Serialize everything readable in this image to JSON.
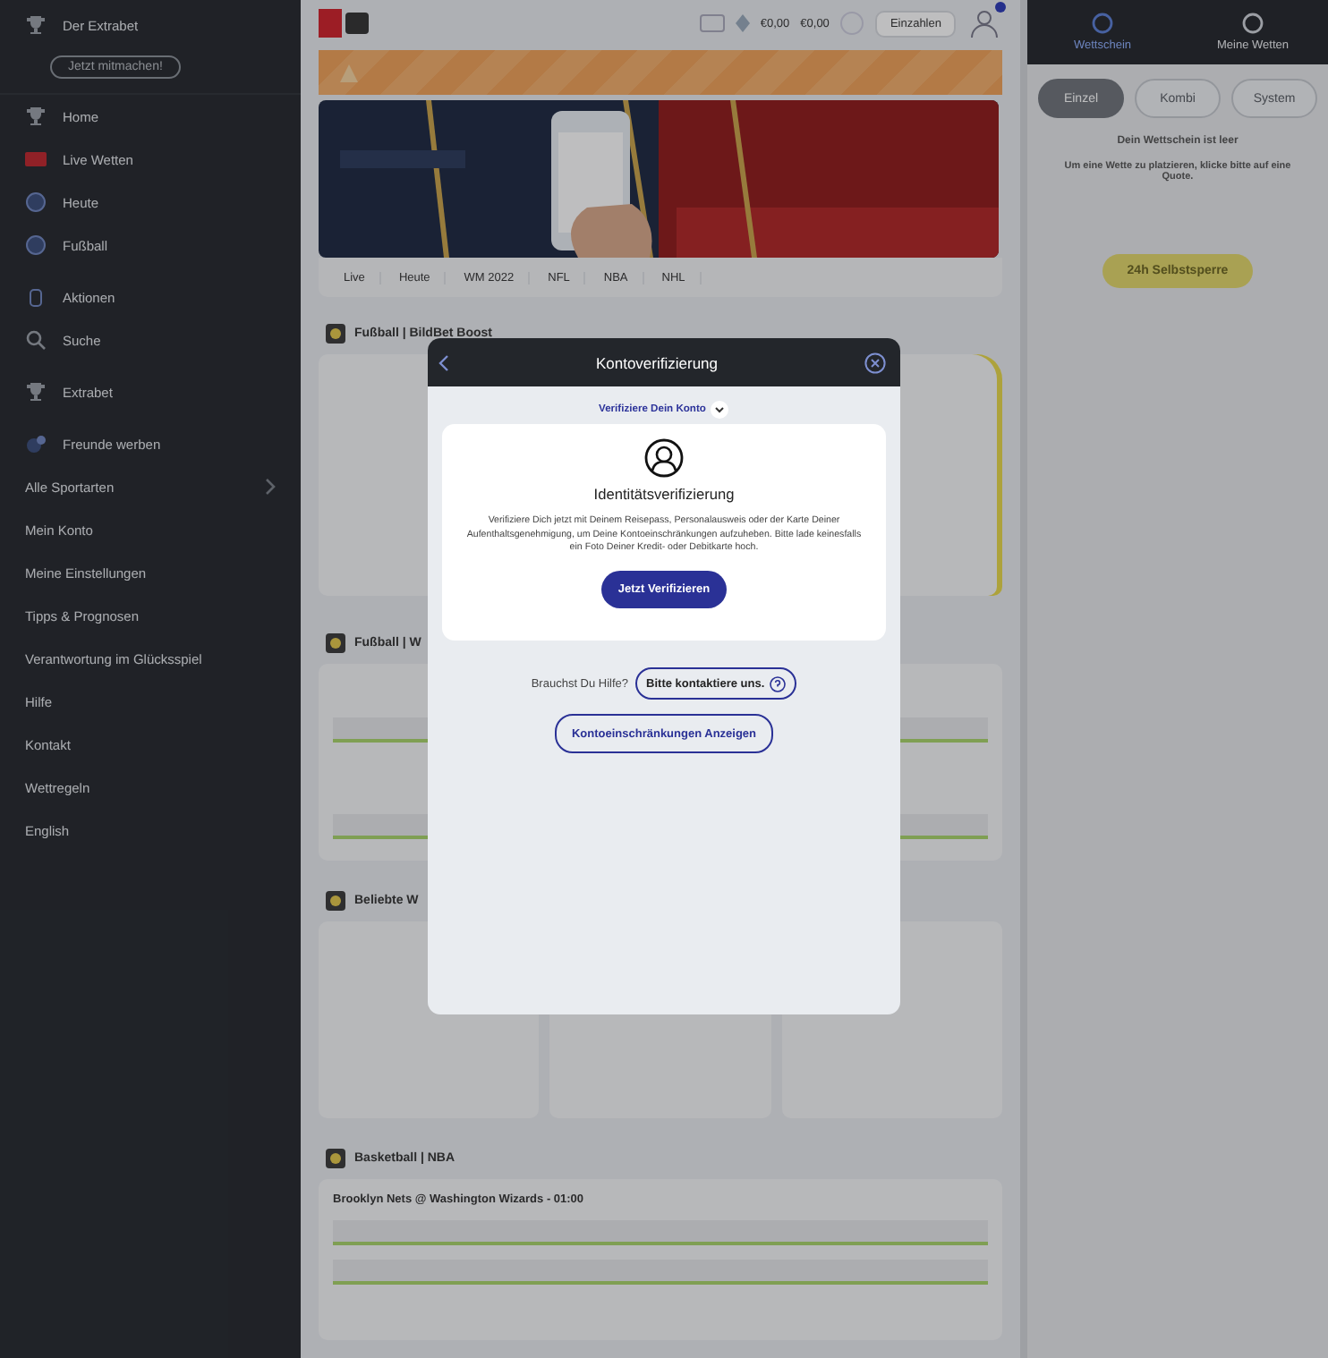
{
  "sidebar": {
    "promo": {
      "title": "Der Extrabet",
      "button": "Jetzt mitmachen!"
    },
    "nav": [
      {
        "label": "Home"
      },
      {
        "label": "Live Wetten"
      },
      {
        "label": "Heute"
      },
      {
        "label": "Fußball"
      },
      {
        "label": "Aktionen"
      },
      {
        "label": "Suche"
      },
      {
        "label": "Extrabet"
      },
      {
        "label": "Freunde werben"
      }
    ],
    "links": [
      {
        "label": "Alle Sportarten",
        "expandable": true
      },
      {
        "label": "Mein Konto",
        "expandable": false
      },
      {
        "label": "Meine Einstellungen",
        "expandable": false
      },
      {
        "label": "Tipps & Prognosen",
        "expandable": false
      },
      {
        "label": "Verantwortung im Glücksspiel",
        "expandable": false
      },
      {
        "label": "Hilfe",
        "expandable": false
      },
      {
        "label": "Kontakt",
        "expandable": false
      },
      {
        "label": "Wettregeln",
        "expandable": false
      },
      {
        "label": "English",
        "expandable": false
      }
    ]
  },
  "header": {
    "balance": "€0,00",
    "bonus": "€0,00",
    "deposit_button": "Einzahlen"
  },
  "tabs": [
    {
      "label": "Live"
    },
    {
      "label": "Heute"
    },
    {
      "label": "WM 2022"
    },
    {
      "label": "NFL"
    },
    {
      "label": "NBA"
    },
    {
      "label": "NHL"
    }
  ],
  "sections": [
    {
      "title": "Fußball | BildBet Boost",
      "kind": "boost"
    },
    {
      "title": "Fußball | W",
      "kind": "matches"
    },
    {
      "title": "Beliebte W",
      "kind": "popular"
    },
    {
      "title": "Basketball | NBA",
      "kind": "nba",
      "match": "Brooklyn Nets @ Washington Wizards - 01:00"
    }
  ],
  "betslip": {
    "tabs": [
      {
        "label": "Wettschein",
        "selected": true
      },
      {
        "label": "Meine Wetten",
        "selected": false
      }
    ],
    "modes": [
      {
        "label": "Einzel",
        "selected": true
      },
      {
        "label": "Kombi",
        "selected": false
      },
      {
        "label": "System",
        "selected": false
      }
    ],
    "empty_title": "Dein Wettschein ist leer",
    "empty_hint": "Um eine Wette zu platzieren, klicke bitte auf eine Quote.",
    "limit_button": "24h Selbstsperre"
  },
  "modal": {
    "title": "Kontoverifizierung",
    "step": "Verifiziere Dein Konto",
    "card_title": "Identitätsverifizierung",
    "card_text": "Verifiziere Dich jetzt mit Deinem Reisepass, Personalausweis oder der Karte Deiner Aufenthaltsgenehmigung, um Deine Kontoeinschränkungen aufzuheben. Bitte lade keinesfalls ein Foto Deiner Kredit- oder Debitkarte hoch.",
    "verify_button": "Jetzt Verifizieren",
    "help_label": "Brauchst Du Hilfe?",
    "contact_button": "Bitte kontaktiere uns.",
    "restrictions_button": "Kontoeinschränkungen Anzeigen"
  }
}
